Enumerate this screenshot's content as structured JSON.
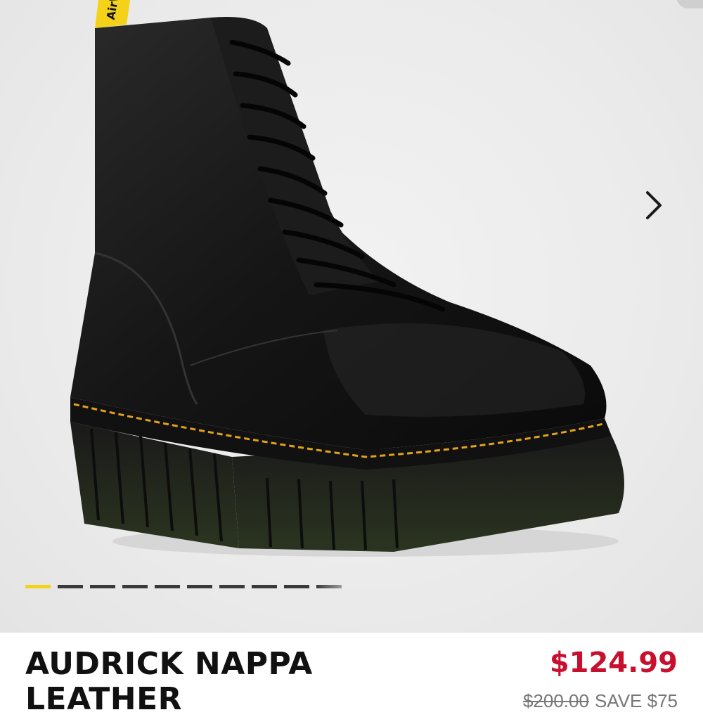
{
  "product": {
    "title": "AUDRICK NAPPA LEATHER",
    "price": "$124.99",
    "original_price": "$200.00",
    "savings": "SAVE $75",
    "pull_tab_text": "AirWair"
  },
  "gallery": {
    "image_count": 10,
    "active_index": 0,
    "next_icon": "chevron-right-icon"
  },
  "colors": {
    "accent_yellow": "#f5d21a",
    "price_red": "#c8102e",
    "dot_inactive": "#3a3a3a"
  }
}
